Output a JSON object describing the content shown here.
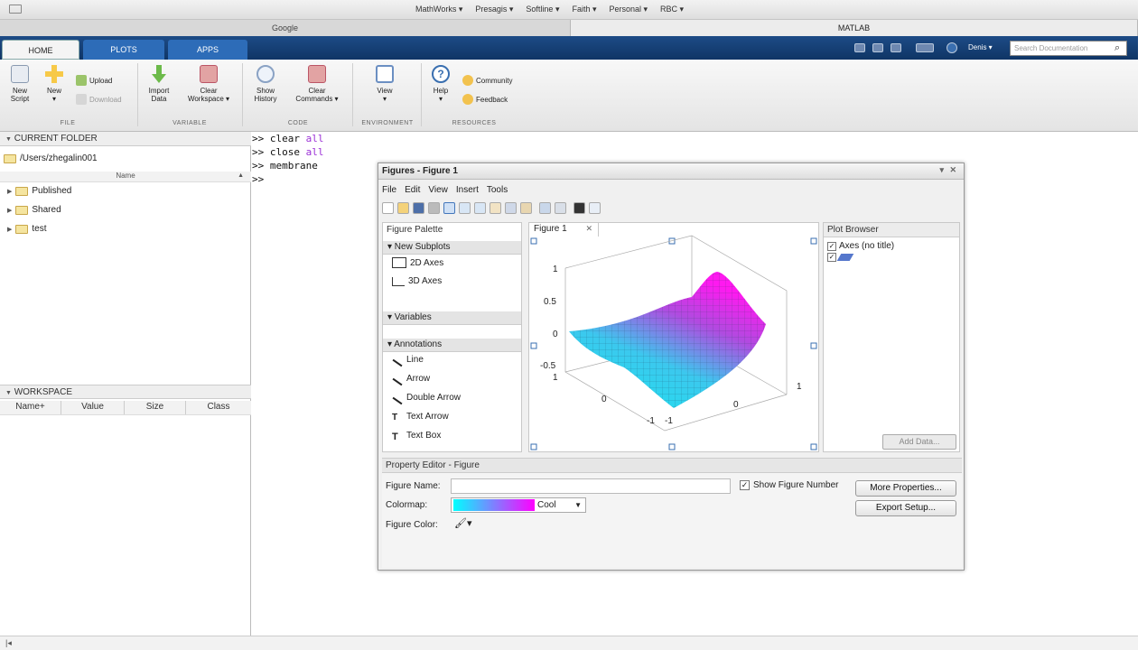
{
  "bookmarks": {
    "items": [
      "MathWorks ▾",
      "Presagis ▾",
      "Softline ▾",
      "Faith ▾",
      "Personal ▾",
      "RBC ▾"
    ]
  },
  "browser_tabs": [
    {
      "label": "Google"
    },
    {
      "label": "MATLAB"
    }
  ],
  "ribbon": {
    "tabs": [
      {
        "label": "HOME"
      },
      {
        "label": "PLOTS"
      },
      {
        "label": "APPS"
      }
    ],
    "user": "Denis ▾",
    "search_placeholder": "Search Documentation",
    "sections": {
      "file": "FILE",
      "variable": "VARIABLE",
      "code": "CODE",
      "environment": "ENVIRONMENT",
      "resources": "RESOURCES"
    },
    "tools": {
      "new_script": [
        "New",
        "Script"
      ],
      "new": [
        "New",
        "▾"
      ],
      "upload": "Upload",
      "download": "Download",
      "import_data": [
        "Import",
        "Data"
      ],
      "clear_workspace": [
        "Clear",
        "Workspace ▾"
      ],
      "show_history": [
        "Show",
        "History"
      ],
      "clear_commands": [
        "Clear",
        "Commands ▾"
      ],
      "view": [
        "View",
        "▾"
      ],
      "help": [
        "Help",
        "▾"
      ],
      "community": "Community",
      "feedback": "Feedback"
    }
  },
  "current_folder": {
    "header": "CURRENT FOLDER",
    "path": "/Users/zhegalin001",
    "column": "Name",
    "folders": [
      "Published",
      "Shared",
      "test"
    ]
  },
  "workspace": {
    "header": "WORKSPACE",
    "columns": [
      "Name+",
      "Value",
      "Size",
      "Class"
    ]
  },
  "command_window": {
    "lines": [
      {
        "prompt": ">>",
        "cmd": "clear",
        "arg": "all"
      },
      {
        "prompt": ">>",
        "cmd": "close",
        "arg": "all"
      },
      {
        "prompt": ">>",
        "cmd": "membrane",
        "arg": ""
      },
      {
        "prompt": ">>",
        "cmd": "",
        "arg": ""
      }
    ]
  },
  "figure": {
    "title": "Figures - Figure 1",
    "menu": [
      "File",
      "Edit",
      "View",
      "Insert",
      "Tools"
    ],
    "palette": {
      "title": "Figure Palette",
      "new_subplots": "▾ New Subplots",
      "subplot_items": [
        "2D Axes",
        "3D Axes"
      ],
      "variables": "▾ Variables",
      "annotations": "▾ Annotations",
      "annotation_items": [
        "Line",
        "Arrow",
        "Double Arrow",
        "Text Arrow",
        "Text Box"
      ]
    },
    "tab": "Figure 1",
    "plot_browser": {
      "title": "Plot Browser",
      "axes": "Axes (no title)",
      "add_data": "Add Data..."
    },
    "axis_ticks": {
      "z": [
        "1",
        "0.5",
        "0",
        "-0.5"
      ],
      "x": [
        "1",
        "0",
        "-1"
      ],
      "y": [
        "1",
        "0",
        "-1"
      ]
    },
    "property_editor": {
      "title": "Property Editor - Figure",
      "figure_name_label": "Figure Name:",
      "figure_name_value": "",
      "show_number": "Show Figure Number",
      "colormap_label": "Colormap:",
      "colormap_value": "Cool",
      "figure_color_label": "Figure Color:",
      "more_properties": "More Properties...",
      "export_setup": "Export Setup..."
    }
  },
  "colors": {
    "ribbon": "#163f73",
    "cool_start": "#00ffff",
    "cool_end": "#ff00ff"
  }
}
